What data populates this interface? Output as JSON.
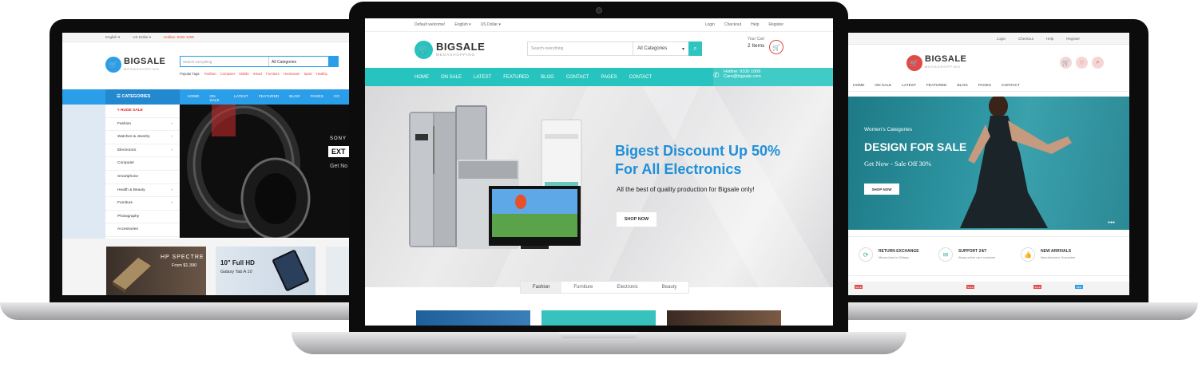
{
  "center": {
    "topbar": {
      "welcome": "Default welcome!",
      "language": "English ▾",
      "currency": "US Dollar ▾",
      "login": "Login",
      "checkout": "Checkout",
      "help": "Help",
      "register": "Register"
    },
    "logo": {
      "name": "BIGSALE",
      "tagline": "MEGASHOPPING"
    },
    "search": {
      "placeholder": "Search everything",
      "category": "All Categories"
    },
    "cart": {
      "label": "Your Cart",
      "items": "2 Items"
    },
    "nav": [
      "HOME",
      "ON SALE",
      "LATEST",
      "FEATURED",
      "BLOG",
      "CONTACT",
      "PAGES",
      "CONTACT"
    ],
    "hotline": {
      "phone": "Hotline: 9100 1009",
      "email": "Care@bigsale.com"
    },
    "hero": {
      "title_line1": "Bigest Discount Up 50%",
      "title_line2": "For All Electronics",
      "subtitle": "All the best of quality production for Bigsale only!",
      "button": "SHOP NOW"
    },
    "tabs": [
      "Fashion",
      "Furniture",
      "Electronic",
      "Beauty"
    ],
    "active_tab": "Fashion",
    "accent": "#27c3be"
  },
  "left": {
    "topbar": {
      "language": "English ▾",
      "currency": "US Dollar ▾",
      "hotline": "Hotline: 9100 1009"
    },
    "logo": {
      "name": "BIGSALE",
      "tagline": "MEGASHOPPING"
    },
    "search": {
      "placeholder": "Search everything",
      "category": "All Categories"
    },
    "popular": {
      "label": "Popular Tags:",
      "tags": [
        "Fashion",
        "Computer",
        "Mobile",
        "Smart",
        "Furniture",
        "Homeware",
        "Sport",
        "Healthy"
      ]
    },
    "categories_title": "CATEGORIES",
    "nav": [
      "HOME",
      "ON SALE",
      "LATEST",
      "FEATURED",
      "BLOG",
      "PAGES",
      "CO"
    ],
    "sidebar": [
      "HUGE SALE",
      "Fashion",
      "Watches & Jewelry",
      "Electronics",
      "Computer",
      "Smartphone",
      "Health & Beauty",
      "Furniture",
      "Photography",
      "Accessories"
    ],
    "banner": {
      "brand": "SONY",
      "tag": "EXT",
      "cta": "Get No"
    },
    "cards": {
      "hp_title": "HP SPECTRE",
      "hp_price": "From $1.390",
      "tab_title": "10\" Full HD",
      "tab_sub": "Galaxy Tab A 10"
    },
    "accent": "#2a9ee8"
  },
  "right": {
    "topbar": {
      "login": "Login",
      "checkout": "Checkout",
      "help": "Help",
      "register": "Register"
    },
    "logo": {
      "name": "BIGSALE",
      "tagline": "MEGASHOPPING"
    },
    "nav": [
      "HOME",
      "ON SALE",
      "LATEST",
      "FEATURED",
      "BLOG",
      "PAGES",
      "CONTACT"
    ],
    "hero": {
      "sub": "Women's Categories",
      "title": "DESIGN FOR SALE",
      "get": "Get Now - Sale Off 30%",
      "button": "SHOP NOW"
    },
    "features": [
      {
        "title": "RETURN EXCHANGE",
        "desc": "Money back in 30days"
      },
      {
        "title": "SUPPORT 24/7",
        "desc": "Alway online care customer"
      },
      {
        "title": "NEW ARRIVALS",
        "desc": "Manufacturers Guarantee"
      }
    ],
    "badges": [
      "SALE",
      "SALE",
      "SALE",
      "NEW"
    ],
    "accent": "#e24a4a"
  }
}
